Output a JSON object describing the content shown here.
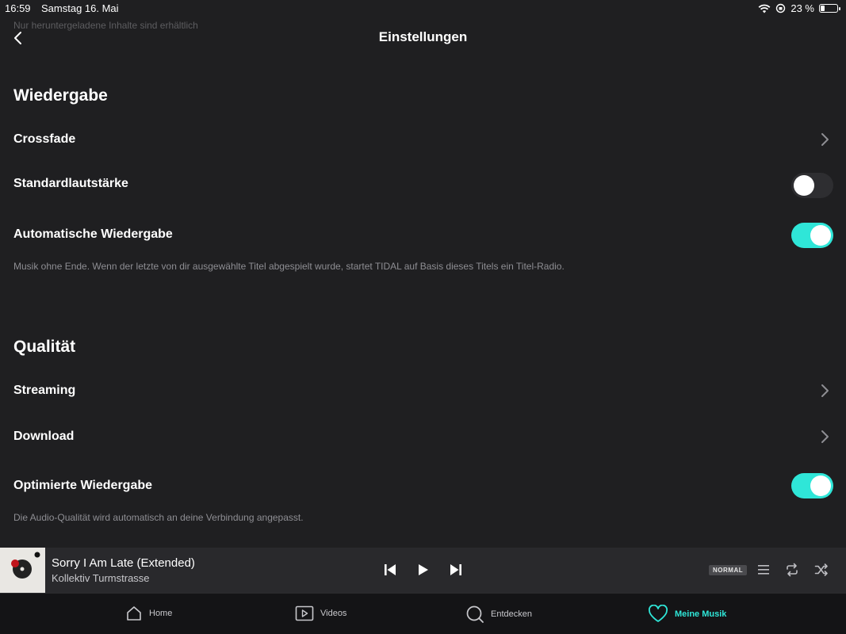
{
  "status": {
    "time": "16:59",
    "date": "Samstag 16. Mai",
    "battery": "23 %"
  },
  "ghost_text": "Nur heruntergeladene Inhalte sind erhältlich",
  "header": {
    "title": "Einstellungen"
  },
  "sections": {
    "playback": {
      "title": "Wiedergabe",
      "crossfade": "Crossfade",
      "standard_volume": "Standardlautstärke",
      "autoplay": "Automatische Wiedergabe",
      "autoplay_desc": "Musik ohne Ende. Wenn der letzte von dir ausgewählte Titel abgespielt wurde, startet TIDAL auf Basis dieses Titels ein Titel-Radio."
    },
    "quality": {
      "title": "Qualität",
      "streaming": "Streaming",
      "download": "Download",
      "optimized": "Optimierte Wiedergabe",
      "optimized_desc": "Die Audio-Qualität wird automatisch an deine Verbindung angepasst."
    }
  },
  "toggles": {
    "standard_volume": false,
    "autoplay": true,
    "optimized": true
  },
  "player": {
    "title": "Sorry I Am Late (Extended)",
    "artist": "Kollektiv Turmstrasse",
    "quality_badge": "NORMAL"
  },
  "tabs": {
    "home": "Home",
    "videos": "Videos",
    "explore": "Entdecken",
    "my_music": "Meine Musik"
  },
  "colors": {
    "accent": "#2fe6d8",
    "background": "#1f1f21"
  }
}
